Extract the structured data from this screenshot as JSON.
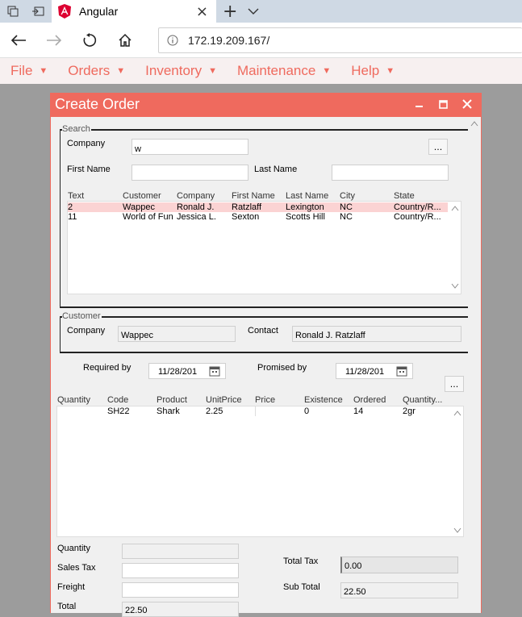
{
  "browser": {
    "tab_title": "Angular",
    "url": "172.19.209.167/",
    "new_tab_glyph": "+",
    "close_glyph": "×"
  },
  "menu": [
    {
      "label": "File"
    },
    {
      "label": "Orders"
    },
    {
      "label": "Inventory"
    },
    {
      "label": "Maintenance"
    },
    {
      "label": "Help"
    }
  ],
  "window": {
    "title": "Create Order",
    "minimize": "−",
    "close": "×"
  },
  "search": {
    "legend": "Search",
    "company_label": "Company",
    "company_value": "w",
    "browse_label": "...",
    "first_name_label": "First Name",
    "first_name_value": "",
    "last_name_label": "Last Name",
    "last_name_value": "",
    "columns": [
      "Text",
      "Customer",
      "Company",
      "First Name",
      "Last Name",
      "City",
      "State"
    ],
    "rows": [
      {
        "text": "2",
        "customer": "Wappec",
        "company": "Ronald J.",
        "first_name": "Ratzlaff",
        "last_name": "Lexington",
        "city": "NC",
        "state": "Country/R..."
      },
      {
        "text": "11",
        "customer": "World of Fun",
        "company": "Jessica L.",
        "first_name": "Sexton",
        "last_name": "Scotts Hill",
        "city": "NC",
        "state": "Country/R..."
      }
    ]
  },
  "customer": {
    "legend": "Customer",
    "company_label": "Company",
    "company_value": "Wappec",
    "contact_label": "Contact",
    "contact_value": "Ronald J. Ratzlaff"
  },
  "dates": {
    "required_label": "Required by",
    "required_value": "11/28/201",
    "promised_label": "Promised by",
    "promised_value": "11/28/201",
    "browse_label": "..."
  },
  "items": {
    "columns": [
      "Quantity",
      "Code",
      "Product",
      "UnitPrice",
      "Price",
      "Existence",
      "Ordered",
      "Quantity..."
    ],
    "rows": [
      {
        "quantity": "",
        "code": "SH22",
        "product": "Shark",
        "unit_price": "2.25",
        "price": "",
        "existence": "0",
        "ordered": "14",
        "quantity2": "2gr"
      }
    ]
  },
  "totals": {
    "quantity_label": "Quantity",
    "quantity_value": "",
    "sales_tax_label": "Sales Tax",
    "sales_tax_value": "",
    "freight_label": "Freight",
    "freight_value": "",
    "total_label": "Total",
    "total_value": "22.50",
    "total_tax_label": "Total Tax",
    "total_tax_value": "0.00",
    "sub_total_label": "Sub Total",
    "sub_total_value": "22.50"
  },
  "colors": {
    "accent": "#ef6a5e",
    "selected_row": "#fbd3d3",
    "tabbar": "#cfd9e4"
  }
}
